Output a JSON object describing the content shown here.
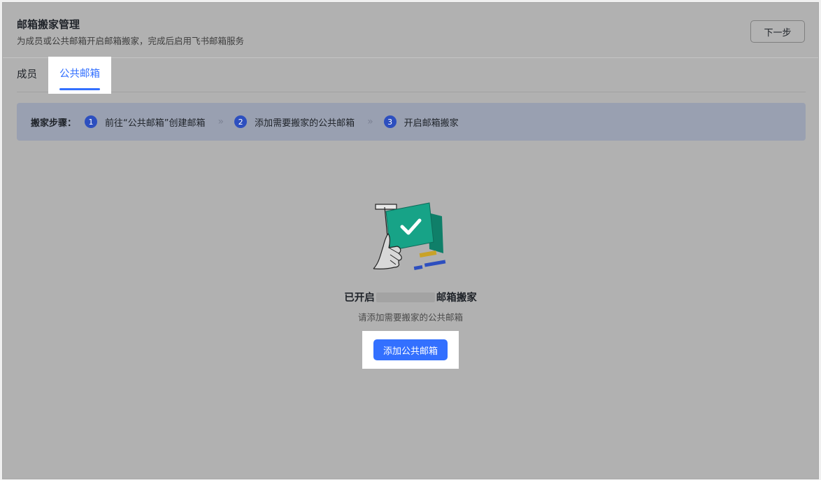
{
  "header": {
    "title": "邮箱搬家管理",
    "subtitle": "为成员或公共邮箱开启邮箱搬家，完成后启用飞书邮箱服务",
    "next_label": "下一步"
  },
  "tabs": [
    {
      "label": "成员",
      "active": false
    },
    {
      "label": "公共邮箱",
      "active": true
    }
  ],
  "steps": {
    "lead": "搬家步骤：",
    "items": [
      {
        "num": "1",
        "text": "前往“公共邮箱”创建邮箱"
      },
      {
        "num": "2",
        "text": "添加需要搬家的公共邮箱"
      },
      {
        "num": "3",
        "text": "开启邮箱搬家"
      }
    ],
    "separator": "»"
  },
  "empty_state": {
    "title_prefix": "已开启",
    "title_suffix": "邮箱搬家",
    "hint": "请添加需要搬家的公共邮箱",
    "button_label": "添加公共邮箱",
    "illustration": "hand-holding-checkmark-flag-icon"
  },
  "colors": {
    "accent": "#3370ff",
    "step_badge": "#2d4fbf",
    "illus_green": "#17a387",
    "illus_yellow": "#c9a227",
    "illus_blue": "#2d4fbf"
  }
}
